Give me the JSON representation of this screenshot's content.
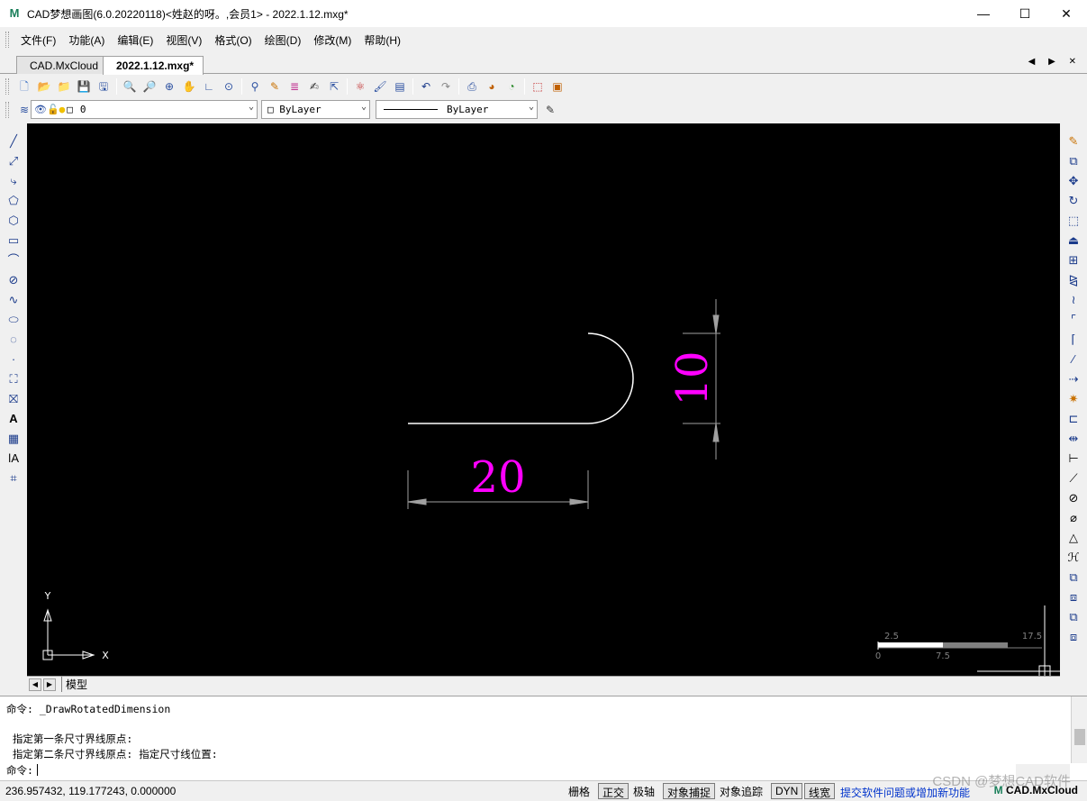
{
  "window": {
    "title": "CAD梦想画图(6.0.20220118)<姓赵的呀。,会员1> - 2022.1.12.mxg*",
    "logo": "M",
    "minimize": "—",
    "maximize": "☐",
    "close": "✕"
  },
  "menu": [
    "文件(F)",
    "功能(A)",
    "编辑(E)",
    "视图(V)",
    "格式(O)",
    "绘图(D)",
    "修改(M)",
    "帮助(H)"
  ],
  "tabs": [
    {
      "label": "CAD.MxCloud",
      "active": false
    },
    {
      "label": "2022.1.12.mxg*",
      "active": true
    }
  ],
  "tab_nav": "◀ ▶ ✕",
  "layer": {
    "name": "0",
    "color": "□ ByLayer",
    "linetype": "ByLayer"
  },
  "canvas": {
    "background": "#000000",
    "dim_color": "#ff00ff",
    "dim_horizontal_text": "20",
    "dim_vertical_text": "10",
    "ucs_x": "X",
    "ucs_y": "Y",
    "scale_top_labels": [
      "2.5",
      "17.5"
    ],
    "scale_bottom_labels": [
      "0",
      "7.5"
    ]
  },
  "model_tab": "模型",
  "command": {
    "lines": [
      "命令: _DrawRotatedDimension",
      "",
      " 指定第一条尺寸界线原点:",
      " 指定第二条尺寸界线原点: 指定尺寸线位置:"
    ],
    "prompt": "命令:"
  },
  "status": {
    "coords": "236.957432,  119.177243,  0.000000",
    "buttons": [
      {
        "label": "栅格",
        "on": false
      },
      {
        "label": "正交",
        "on": true
      },
      {
        "label": "极轴",
        "on": false
      },
      {
        "label": "对象捕捉",
        "on": true
      },
      {
        "label": "对象追踪",
        "on": false
      },
      {
        "label": "DYN",
        "on": true
      },
      {
        "label": "线宽",
        "on": true
      }
    ],
    "link": "提交软件问题或增加新功能",
    "brand": "CAD.MxCloud",
    "watermark": "CSDN @梦想CAD软件"
  }
}
